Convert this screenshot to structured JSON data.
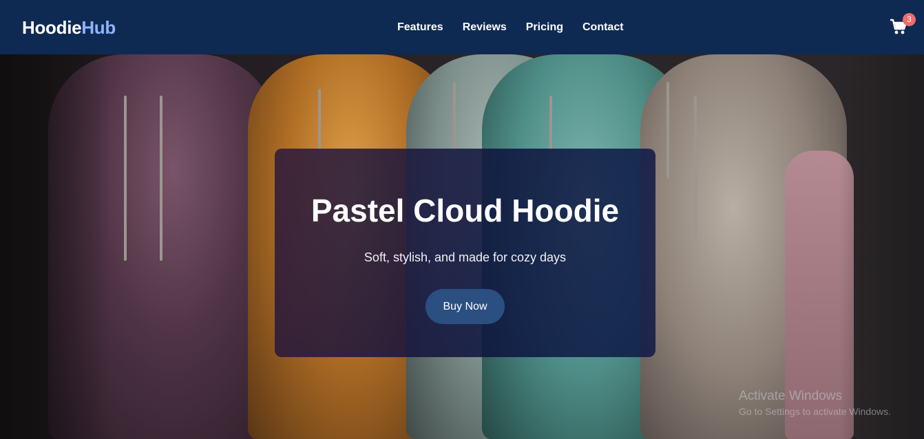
{
  "brand": {
    "name_main": "Hoodie",
    "name_accent": "Hub"
  },
  "nav": {
    "links": [
      {
        "label": "Features"
      },
      {
        "label": "Reviews"
      },
      {
        "label": "Pricing"
      },
      {
        "label": "Contact"
      }
    ]
  },
  "cart": {
    "icon": "shopping-cart-icon",
    "count": "3"
  },
  "hero": {
    "title": "Pastel Cloud Hoodie",
    "subtitle": "Soft, stylish, and made for cozy days",
    "cta_label": "Buy Now"
  },
  "watermark": {
    "title": "Activate Windows",
    "subtitle": "Go to Settings to activate Windows."
  },
  "colors": {
    "navbar": "#0f2a52",
    "brand_accent": "#8fb4ff",
    "button": "#2a4f80",
    "badge": "#f06b6b"
  }
}
